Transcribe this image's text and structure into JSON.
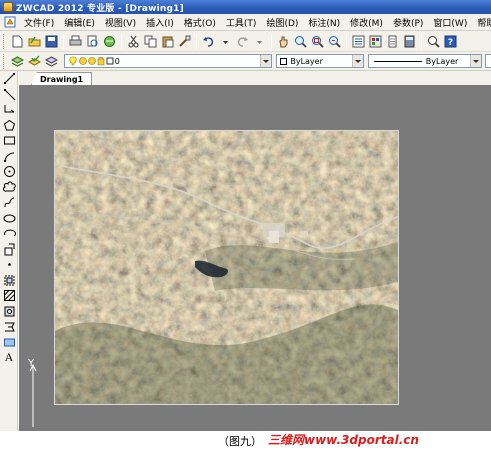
{
  "window": {
    "title": "ZWCAD 2012 专业版 - [Drawing1]"
  },
  "menu": {
    "items": [
      "文件(F)",
      "编辑(E)",
      "视图(V)",
      "插入(I)",
      "格式(O)",
      "工具(T)",
      "绘图(D)",
      "标注(N)",
      "修改(M)",
      "参数(P)",
      "窗口(W)",
      "帮助(H)"
    ]
  },
  "properties_bar": {
    "layer_value": "0",
    "color_value": "ByLayer",
    "linetype_value": "ByLayer"
  },
  "document_tab": {
    "label": "Drawing1"
  },
  "ucs": {
    "y_label": "Y"
  },
  "caption": {
    "figure_label": "（图九）",
    "watermark": "三维网www.3dportal.cn"
  },
  "colors": {
    "title_bar": "#2a5bb8",
    "canvas": "#7a7a7a",
    "watermark": "#e11b1b"
  }
}
